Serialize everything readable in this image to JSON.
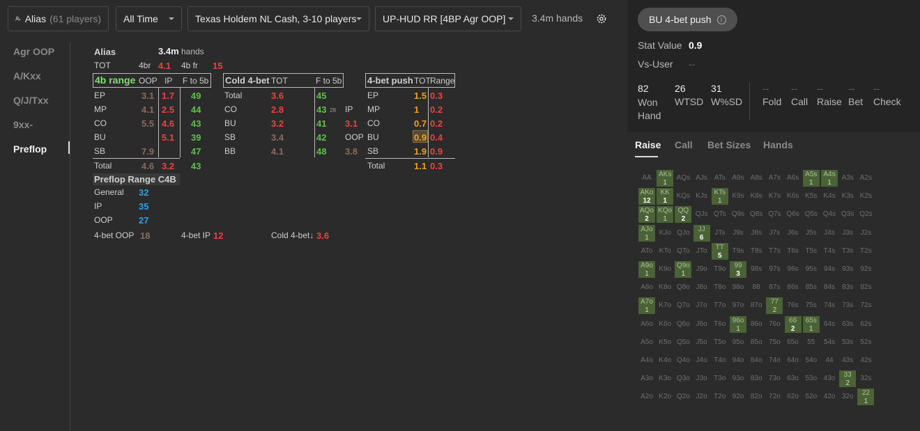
{
  "toolbar": {
    "alias_label": "Alias",
    "alias_players": "(61 players)",
    "time_filter": "All Time",
    "game_filter": "Texas Holdem NL Cash, 3-10 players",
    "hud_filter": "UP-HUD RR [4BP Agr OOP]",
    "hands_count": "3.4m hands",
    "icons": [
      "user-filter-icon",
      "chevron-down-icon",
      "gear-icon"
    ]
  },
  "sidenav": {
    "items": [
      "Agr OOP",
      "A/Kxx",
      "Q/J/Txx",
      "9xx-",
      "Preflop"
    ],
    "active": "Preflop"
  },
  "panel": {
    "name": "Alias",
    "hands": "3.4m",
    "hands_unit": "hands",
    "tot_row": {
      "label": "TOT",
      "fourbr_label": "4br",
      "fourbr": "4.1",
      "fourbfr_label": "4b fr",
      "fourbfr": "15"
    },
    "range4b": {
      "title": "4b range",
      "cols": [
        "OOP",
        "IP",
        "F to 5b"
      ],
      "rows": [
        {
          "pos": "EP",
          "oop": "3.1",
          "ip": "1.7",
          "f5b": "49"
        },
        {
          "pos": "MP",
          "oop": "4.1",
          "ip": "2.5",
          "f5b": "44"
        },
        {
          "pos": "CO",
          "oop": "5.5",
          "ip": "4.6",
          "f5b": "43"
        },
        {
          "pos": "BU",
          "oop": "",
          "ip": "5.1",
          "f5b": "39"
        },
        {
          "pos": "SB",
          "oop": "7.9",
          "ip": "",
          "f5b": "47"
        }
      ],
      "total": {
        "label": "Total",
        "oop": "4.6",
        "ip": "3.2",
        "f5b": "43"
      }
    },
    "cold4bet": {
      "title": "Cold 4-bet",
      "cols": [
        "TOT",
        "F to 5b"
      ],
      "rows": [
        {
          "pos": "Total",
          "tot": "3.6",
          "f5b": "45",
          "sub_label": "",
          "sub": ""
        },
        {
          "pos": "CO",
          "tot": "2.8",
          "f5b": "43",
          "f5b_small": "28",
          "sub_label": "IP",
          "sub": ""
        },
        {
          "pos": "BU",
          "tot": "3.2",
          "f5b": "41",
          "sub_label": "",
          "sub": "3.1"
        },
        {
          "pos": "SB",
          "tot": "3.4",
          "f5b": "42",
          "sub_label": "OOP",
          "sub": ""
        },
        {
          "pos": "BB",
          "tot": "4.1",
          "f5b": "48",
          "sub_label": "",
          "sub": "3.8"
        }
      ]
    },
    "push4bet": {
      "title": "4-bet push",
      "cols": [
        "TOT",
        "Range"
      ],
      "rows": [
        {
          "pos": "EP",
          "tot": "1.5",
          "range": "0.3"
        },
        {
          "pos": "MP",
          "tot": "1",
          "range": "0.2"
        },
        {
          "pos": "CO",
          "tot": "0.7",
          "range": "0.2"
        },
        {
          "pos": "BU",
          "tot": "0.9",
          "range": "0.4"
        },
        {
          "pos": "SB",
          "tot": "1.9",
          "range": "0.9"
        }
      ],
      "total": {
        "label": "Total",
        "tot": "1.1",
        "range": "0.3"
      }
    },
    "prc4b": {
      "title": "Preflop Range C4B",
      "rows": [
        {
          "label": "General",
          "value": "32"
        },
        {
          "label": "IP",
          "value": "35"
        },
        {
          "label": "OOP",
          "value": "27"
        }
      ]
    },
    "bottom": {
      "oop_label": "4-bet OOP",
      "oop": "18",
      "ip_label": "4-bet IP",
      "ip": "12",
      "cold_label": "Cold 4-bet↓",
      "cold": "3.6"
    }
  },
  "right": {
    "stat_name": "BU 4-bet push",
    "stat_value_label": "Stat Value",
    "stat_value": "0.9",
    "vs_user_label": "Vs-User",
    "vs_user_value": "--",
    "metrics": [
      {
        "value": "82",
        "label": "Won Hand"
      },
      {
        "value": "26",
        "label": "WTSD"
      },
      {
        "value": "31",
        "label": "W%SD"
      }
    ],
    "actions": [
      {
        "value": "--",
        "label": "Fold"
      },
      {
        "value": "--",
        "label": "Call"
      },
      {
        "value": "--",
        "label": "Raise"
      },
      {
        "value": "--",
        "label": "Bet"
      },
      {
        "value": "--",
        "label": "Check"
      }
    ],
    "tabs": [
      "Raise",
      "Call",
      "Bet Sizes",
      "Hands"
    ],
    "active_tab": "Raise",
    "grid_ranks": [
      "A",
      "K",
      "Q",
      "J",
      "T",
      "9",
      "8",
      "7",
      "6",
      "5",
      "4",
      "3",
      "2"
    ],
    "highlighted": {
      "AKs": "1",
      "A5s": "1",
      "A4s": "1",
      "AKo": "12",
      "KK": "1",
      "KTs": "1",
      "AQo": "2",
      "KQo": "1",
      "QQ": "2",
      "AJo": "1",
      "JJ": "6",
      "TT": "5",
      "A9o": "1",
      "Q9o": "1",
      "99": "3",
      "A7o": "1",
      "77": "2",
      "96o": "1",
      "66": "2",
      "65s": "1",
      "33": "2",
      "22": "1"
    },
    "small_count": [
      "KQo",
      "A9o",
      "Q9o",
      "A7o",
      "96o",
      "AJo",
      "KTs",
      "AKs",
      "A5s",
      "A4s",
      "65s",
      "22",
      "33",
      "77"
    ]
  }
}
